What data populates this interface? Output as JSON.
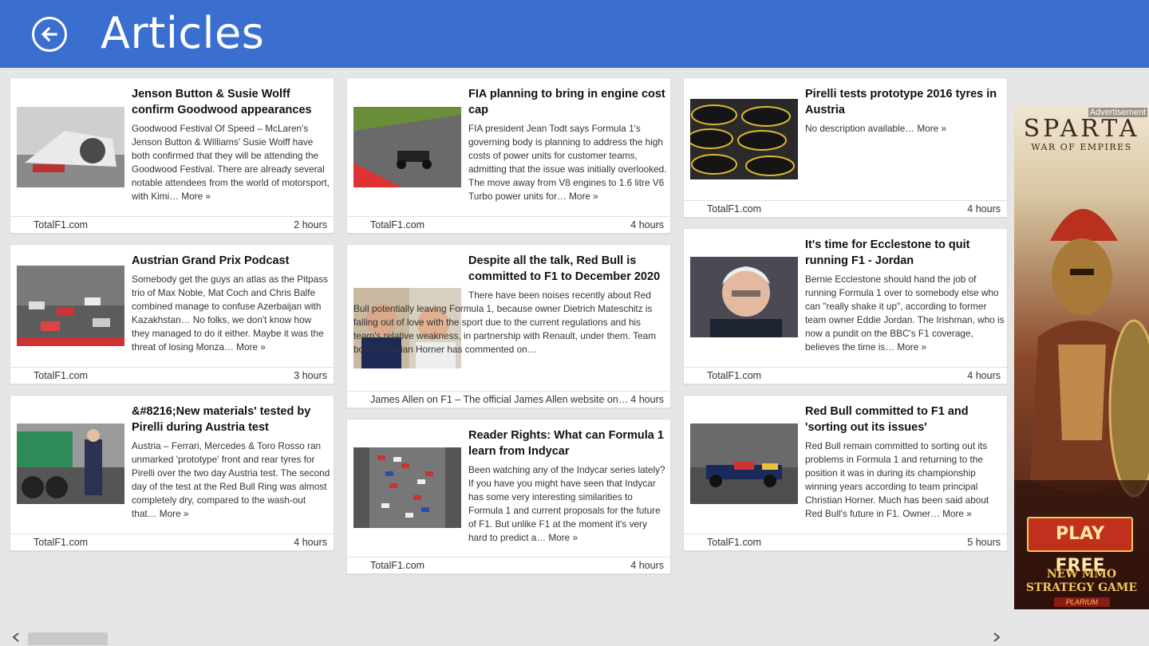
{
  "header": {
    "title": "Articles",
    "back_icon": "back-arrow-icon"
  },
  "articles": [
    {
      "title": "Jenson Button & Susie Wolff confirm Goodwood appearances",
      "desc": "Goodwood Festival Of Speed – McLaren's Jenson Button & Williams' Susie Wolff have both confirmed that they will be attending the Goodwood Festival. There are already several notable attendees from the world of motorsport, with Kimi…",
      "more": "More »",
      "source": "TotalF1.com",
      "time": "2 hours"
    },
    {
      "title": "Austrian Grand Prix Podcast",
      "desc": "Somebody get the guys an atlas as the Pitpass trio of Max Noble, Mat Coch and Chris Balfe combined manage to confuse Azerbaijan with Kazakhstan… No folks, we don't know how they managed to do it either. Maybe it was the threat of losing Monza…",
      "more": "More »",
      "source": "TotalF1.com",
      "time": "3 hours"
    },
    {
      "title": "&#8216;New materials' tested by Pirelli during Austria test",
      "desc": "Austria – Ferrari, Mercedes & Toro Rosso ran unmarked 'prototype' front and rear tyres for Pirelli over the two day Austria test. The second day of the test at the Red Bull Ring was almost completely dry, compared to the wash-out that…",
      "more": "More »",
      "source": "TotalF1.com",
      "time": "4 hours"
    },
    {
      "title": "FIA planning to bring in engine cost cap",
      "desc": "FIA president Jean Todt says Formula 1's governing body is planning to address the high costs of power units for customer teams, admitting that the issue was initially overlooked. The move away from V8 engines to 1.6 litre V6 Turbo power units for…",
      "more": "More »",
      "source": "TotalF1.com",
      "time": "4 hours"
    },
    {
      "title": "Despite all the talk, Red Bull is committed to F1 to December 2020",
      "desc": "There have been noises recently about Red Bull potentially leaving Formula 1, because owner Dietrich Mateschitz is falling out of love with the sport due to the current regulations and his team's relative weakness, in partnership with Renault, under them. Team boss Christian Horner has commented on…",
      "more": "",
      "source": "James Allen on F1 – The official James Allen website on…",
      "time": "4 hours"
    },
    {
      "title": "Reader Rights: What can Formula 1 learn from Indycar",
      "desc": "Been watching any of the Indycar series lately? If you have you might have seen that Indycar has some very interesting similarities to Formula 1 and current proposals for the future of F1. But unlike F1 at the moment it's very hard to predict a…",
      "more": "More »",
      "source": "TotalF1.com",
      "time": "4 hours"
    },
    {
      "title": "Pirelli tests prototype 2016 tyres in Austria",
      "desc": "No description available…",
      "more": "More »",
      "source": "TotalF1.com",
      "time": "4 hours"
    },
    {
      "title": "It's time for Ecclestone to quit running F1 - Jordan",
      "desc": "Bernie Ecclestone should hand the job of running Formula 1 over to somebody else who can \"really shake it up\", according to former team owner Eddie Jordan. The Irishman, who is now a pundit on the BBC's F1 coverage, believes the time is…",
      "more": "More »",
      "source": "TotalF1.com",
      "time": "4 hours"
    },
    {
      "title": "Red Bull committed to F1 and 'sorting out its issues'",
      "desc": "Red Bull remain committed to sorting out its problems in Formula 1 and returning to the position it was in during its championship winning years according to team principal Christian Horner. Much has been said about Red Bull's future in F1. Owner…",
      "more": "More »",
      "source": "TotalF1.com",
      "time": "5 hours"
    }
  ],
  "ad": {
    "label": "Advertisement",
    "title": "SPARTA",
    "subtitle": "WAR OF EMPIRES",
    "cta": "PLAY FREE",
    "tagline_1": "NEW MMO",
    "tagline_2": "STRATEGY GAME",
    "brand": "PLARIUM"
  },
  "scrollbar": {
    "left_icon": "chevron-left-icon",
    "right_icon": "chevron-right-icon"
  }
}
